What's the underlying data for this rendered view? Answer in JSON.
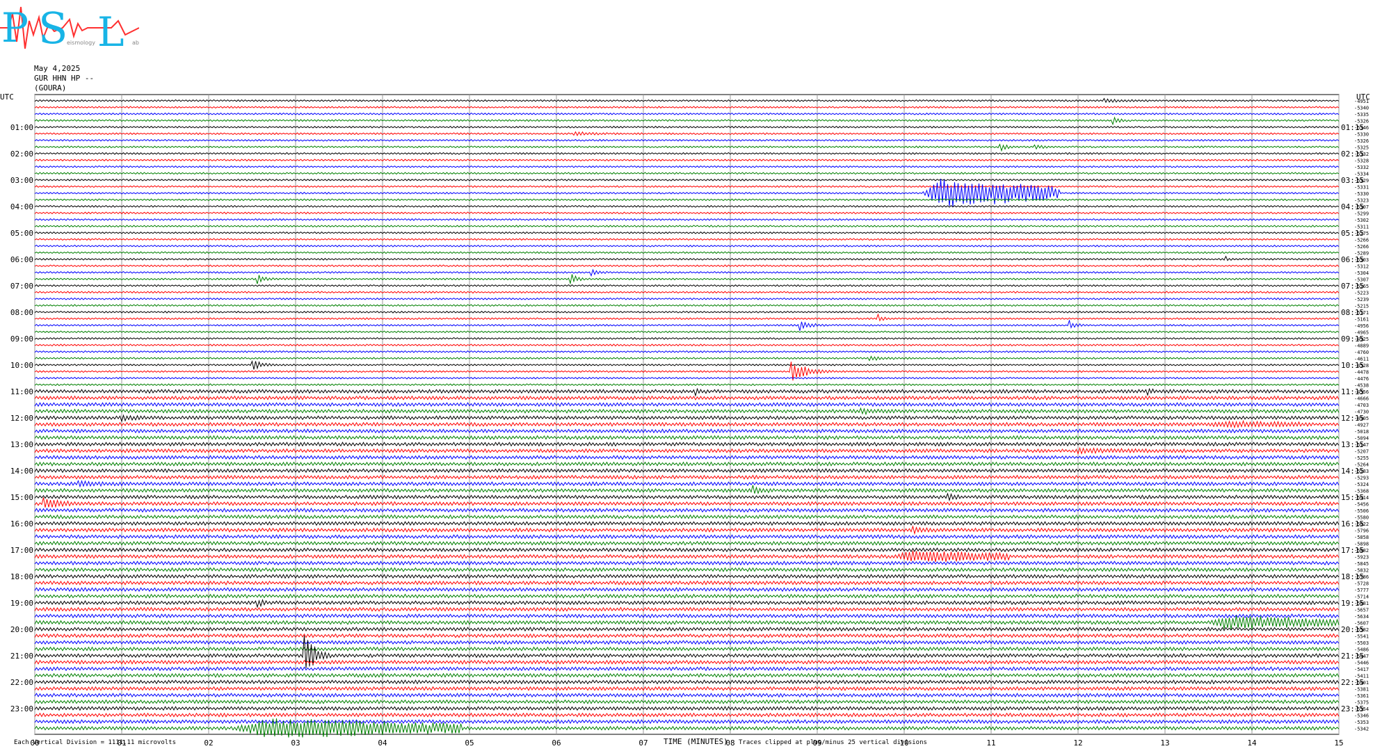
{
  "logo": {
    "text": [
      "P",
      "S",
      "L"
    ],
    "subtitle_fragments": [
      "eismology",
      "ab"
    ]
  },
  "header": {
    "date": "May 4,2025",
    "channel": "GUR HHN HP --",
    "station": "(GOURA)"
  },
  "chart_data": {
    "type": "line",
    "title": "",
    "xlabel": "TIME (MINUTES)",
    "x_ticks": [
      "00",
      "01",
      "02",
      "03",
      "04",
      "05",
      "06",
      "07",
      "08",
      "09",
      "10",
      "11",
      "12",
      "13",
      "14",
      "15"
    ],
    "xlim": [
      0,
      15
    ],
    "left_axis_label": "UTC",
    "right_axis_label": "UTC",
    "left_hour_labels": [
      "01:00",
      "02:00",
      "03:00",
      "04:00",
      "05:00",
      "06:00",
      "07:00",
      "08:00",
      "09:00",
      "10:00",
      "11:00",
      "12:00",
      "13:00",
      "14:00",
      "15:00",
      "16:00",
      "17:00",
      "18:00",
      "19:00",
      "20:00",
      "21:00",
      "22:00",
      "23:00"
    ],
    "right_hour_labels": [
      "01:15",
      "02:15",
      "03:15",
      "04:15",
      "05:15",
      "06:15",
      "07:15",
      "08:15",
      "09:15",
      "10:15",
      "11:15",
      "12:15",
      "13:15",
      "14:15",
      "15:15",
      "16:15",
      "17:15",
      "18:15",
      "19:15",
      "20:15",
      "21:15",
      "22:15",
      "23:15"
    ],
    "trace_colors": [
      "#000000",
      "#ff0000",
      "#0000ff",
      "#008000"
    ],
    "trace_count": 96,
    "right_values": [
      "-4951",
      "-5340",
      "-5335",
      "-5326",
      "-5346",
      "-5330",
      "-5326",
      "-5325",
      "-5332",
      "-5328",
      "-5332",
      "-5334",
      "-5329",
      "-5331",
      "-5330",
      "-5323",
      "-5307",
      "-5299",
      "-5302",
      "-5311",
      "-5275",
      "-5266",
      "-5266",
      "-5289",
      "-5303",
      "-5312",
      "-5304",
      "-5307",
      "-5265",
      "-5223",
      "-5239",
      "-5215",
      "-5171",
      "-5161",
      "-4956",
      "-4965",
      "-4925",
      "-4889",
      "-4760",
      "-4611",
      "-4528",
      "-4478",
      "-4476",
      "-4538",
      "-4556",
      "-4666",
      "-4703",
      "-4730",
      "-4905",
      "-4927",
      "-5018",
      "-5094",
      "-5147",
      "-5207",
      "-5255",
      "-5264",
      "-5283",
      "-5293",
      "-5324",
      "-5368",
      "-5414",
      "-5456",
      "-5506",
      "-5580",
      "-5622",
      "-5796",
      "-5858",
      "-5898",
      "-5882",
      "-5923",
      "-5845",
      "-5832",
      "-5786",
      "-5728",
      "-5777",
      "-5714",
      "-5681",
      "-5657",
      "-5634",
      "-5607",
      "-5582",
      "-5541",
      "-5503",
      "-5486",
      "-5447",
      "-5446",
      "-5417",
      "-5411",
      "-5401",
      "-5381",
      "-5361",
      "-5375",
      "-5354",
      "-5346",
      "-5353",
      "-5342"
    ],
    "events": [
      {
        "trace": 0,
        "minute": 12.3,
        "duration": 0.7,
        "amp": 2.0
      },
      {
        "trace": 3,
        "minute": 12.4,
        "duration": 0.2,
        "amp": 6
      },
      {
        "trace": 5,
        "minute": 6.2,
        "duration": 0.5,
        "amp": 3
      },
      {
        "trace": 7,
        "minute": 11.1,
        "duration": 0.2,
        "amp": 6
      },
      {
        "trace": 7,
        "minute": 11.5,
        "duration": 0.2,
        "amp": 5
      },
      {
        "trace": 14,
        "minute": 10.2,
        "duration": 1.6,
        "amp": 22
      },
      {
        "trace": 24,
        "minute": 13.7,
        "duration": 0.15,
        "amp": 3
      },
      {
        "trace": 26,
        "minute": 6.4,
        "duration": 0.2,
        "amp": 5
      },
      {
        "trace": 27,
        "minute": 2.55,
        "duration": 0.2,
        "amp": 10
      },
      {
        "trace": 27,
        "minute": 6.15,
        "duration": 0.2,
        "amp": 10
      },
      {
        "trace": 33,
        "minute": 9.7,
        "duration": 0.15,
        "amp": 6
      },
      {
        "trace": 34,
        "minute": 8.8,
        "duration": 0.3,
        "amp": 7
      },
      {
        "trace": 34,
        "minute": 11.9,
        "duration": 0.2,
        "amp": 6
      },
      {
        "trace": 39,
        "minute": 9.6,
        "duration": 0.5,
        "amp": 3
      },
      {
        "trace": 40,
        "minute": 2.5,
        "duration": 0.3,
        "amp": 7
      },
      {
        "trace": 41,
        "minute": 8.7,
        "duration": 0.5,
        "amp": 16
      },
      {
        "trace": 44,
        "minute": 7.6,
        "duration": 0.15,
        "amp": 4
      },
      {
        "trace": 44,
        "minute": 12.8,
        "duration": 0.15,
        "amp": 4
      },
      {
        "trace": 47,
        "minute": 9.5,
        "duration": 0.4,
        "amp": 3
      },
      {
        "trace": 48,
        "minute": 1.0,
        "duration": 0.3,
        "amp": 5
      },
      {
        "trace": 49,
        "minute": 13.5,
        "duration": 1.2,
        "amp": 3
      },
      {
        "trace": 53,
        "minute": 12.0,
        "duration": 1.0,
        "amp": 3
      },
      {
        "trace": 58,
        "minute": 0.5,
        "duration": 0.6,
        "amp": 3
      },
      {
        "trace": 59,
        "minute": 8.25,
        "duration": 0.2,
        "amp": 9
      },
      {
        "trace": 60,
        "minute": 10.5,
        "duration": 0.2,
        "amp": 4
      },
      {
        "trace": 61,
        "minute": 0.1,
        "duration": 0.5,
        "amp": 8
      },
      {
        "trace": 65,
        "minute": 10.1,
        "duration": 0.3,
        "amp": 4
      },
      {
        "trace": 69,
        "minute": 9.9,
        "duration": 1.3,
        "amp": 8
      },
      {
        "trace": 76,
        "minute": 2.55,
        "duration": 0.2,
        "amp": 6
      },
      {
        "trace": 79,
        "minute": 13.5,
        "duration": 1.5,
        "amp": 9
      },
      {
        "trace": 84,
        "minute": 3.1,
        "duration": 0.3,
        "amp": 40
      },
      {
        "trace": 95,
        "minute": 2.3,
        "duration": 2.6,
        "amp": 14
      }
    ]
  },
  "footer": {
    "division": "Each Vertical Division = 1111.11 microvolts",
    "clipped": "Traces clipped at plus/minus 25 vertical divisions"
  }
}
